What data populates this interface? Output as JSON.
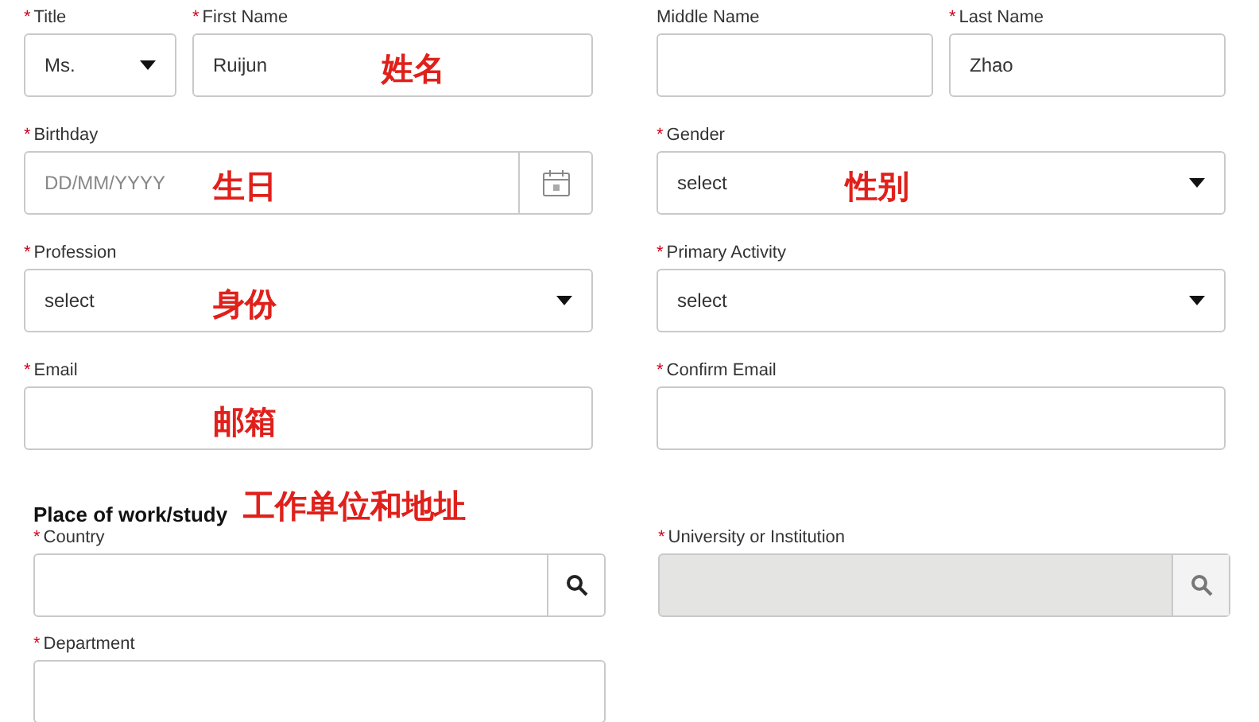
{
  "rows": [
    {
      "left": {
        "fields": [
          {
            "label": "Title",
            "required_mark": "*",
            "kind": "select",
            "value": "Ms.",
            "narrow": true
          },
          {
            "label": "First Name",
            "required_mark": "*",
            "kind": "text",
            "value": "Ruijun",
            "annotation": "姓名"
          }
        ]
      },
      "right": {
        "fields": [
          {
            "label": "Middle Name",
            "kind": "text"
          },
          {
            "label": "Last Name",
            "required_mark": "*",
            "kind": "text",
            "value": "Zhao"
          }
        ]
      }
    },
    {
      "left": {
        "fields": [
          {
            "label": "Birthday",
            "required_mark": "*",
            "kind": "date",
            "placeholder": "DD/MM/YYYY",
            "annotation": "生日"
          }
        ]
      },
      "right": {
        "fields": [
          {
            "label": "Gender",
            "required_mark": "*",
            "kind": "select",
            "value": "select",
            "annotation": "性别"
          }
        ]
      }
    },
    {
      "left": {
        "fields": [
          {
            "label": "Profession",
            "required_mark": "*",
            "kind": "select",
            "value": "select",
            "annotation": "身份"
          }
        ]
      },
      "right": {
        "fields": [
          {
            "label": "Primary Activity",
            "required_mark": "*",
            "kind": "select",
            "value": "select"
          }
        ]
      }
    },
    {
      "left": {
        "fields": [
          {
            "label": "Email",
            "required_mark": "*",
            "kind": "text",
            "annotation": "邮箱"
          }
        ]
      },
      "right": {
        "fields": [
          {
            "label": "Confirm Email",
            "required_mark": "*",
            "kind": "text"
          }
        ]
      }
    }
  ],
  "section": {
    "heading": "Place of work/study",
    "annotation": "工作单位和地址"
  },
  "rows2": [
    {
      "left": {
        "fields": [
          {
            "label": "Country",
            "required_mark": "*",
            "kind": "search"
          }
        ]
      },
      "right": {
        "fields": [
          {
            "label": "University or Institution",
            "required_mark": "*",
            "kind": "search",
            "disabled": true
          }
        ]
      }
    },
    {
      "left": {
        "fields": [
          {
            "label": "Department",
            "required_mark": "*",
            "kind": "text"
          }
        ]
      }
    }
  ]
}
